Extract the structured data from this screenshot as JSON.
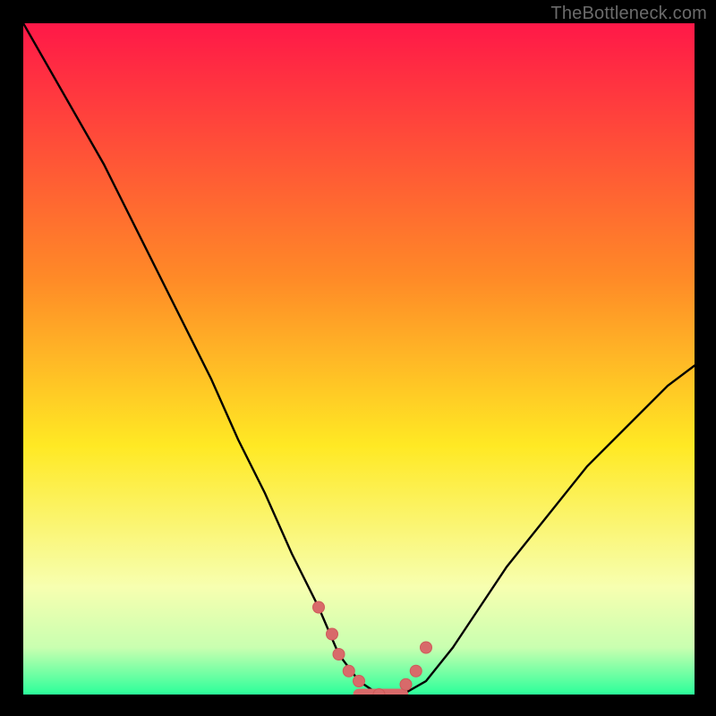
{
  "watermark": "TheBottleneck.com",
  "colors": {
    "background": "#000000",
    "gradient_top": "#ff1848",
    "gradient_mid1": "#ff8a27",
    "gradient_mid2": "#ffe924",
    "gradient_low1": "#f7ffb0",
    "gradient_low2": "#c9ffb0",
    "gradient_bottom": "#2bff9a",
    "curve": "#000000",
    "marker_fill": "#d86a6a",
    "marker_stroke": "#cf5a5a"
  },
  "chart_data": {
    "type": "line",
    "title": "",
    "xlabel": "",
    "ylabel": "",
    "xlim": [
      0,
      100
    ],
    "ylim": [
      0,
      100
    ],
    "x": [
      0,
      4,
      8,
      12,
      16,
      20,
      24,
      28,
      32,
      36,
      40,
      44,
      47,
      50,
      53,
      56.5,
      60,
      64,
      68,
      72,
      76,
      80,
      84,
      88,
      92,
      96,
      100
    ],
    "bottleneck_pct": [
      100,
      93,
      86,
      79,
      71,
      63,
      55,
      47,
      38,
      30,
      21,
      13,
      6,
      2,
      0,
      0,
      2,
      7,
      13,
      19,
      24,
      29,
      34,
      38,
      42,
      46,
      49
    ],
    "markers": {
      "x": [
        44,
        46,
        47,
        48.5,
        50,
        53,
        57,
        58.5,
        60
      ],
      "pct": [
        13,
        9,
        6,
        3.5,
        2,
        0,
        1.5,
        3.5,
        7
      ]
    },
    "flat_segment": {
      "x0": 50,
      "x1": 56.5,
      "pct": 0
    }
  }
}
